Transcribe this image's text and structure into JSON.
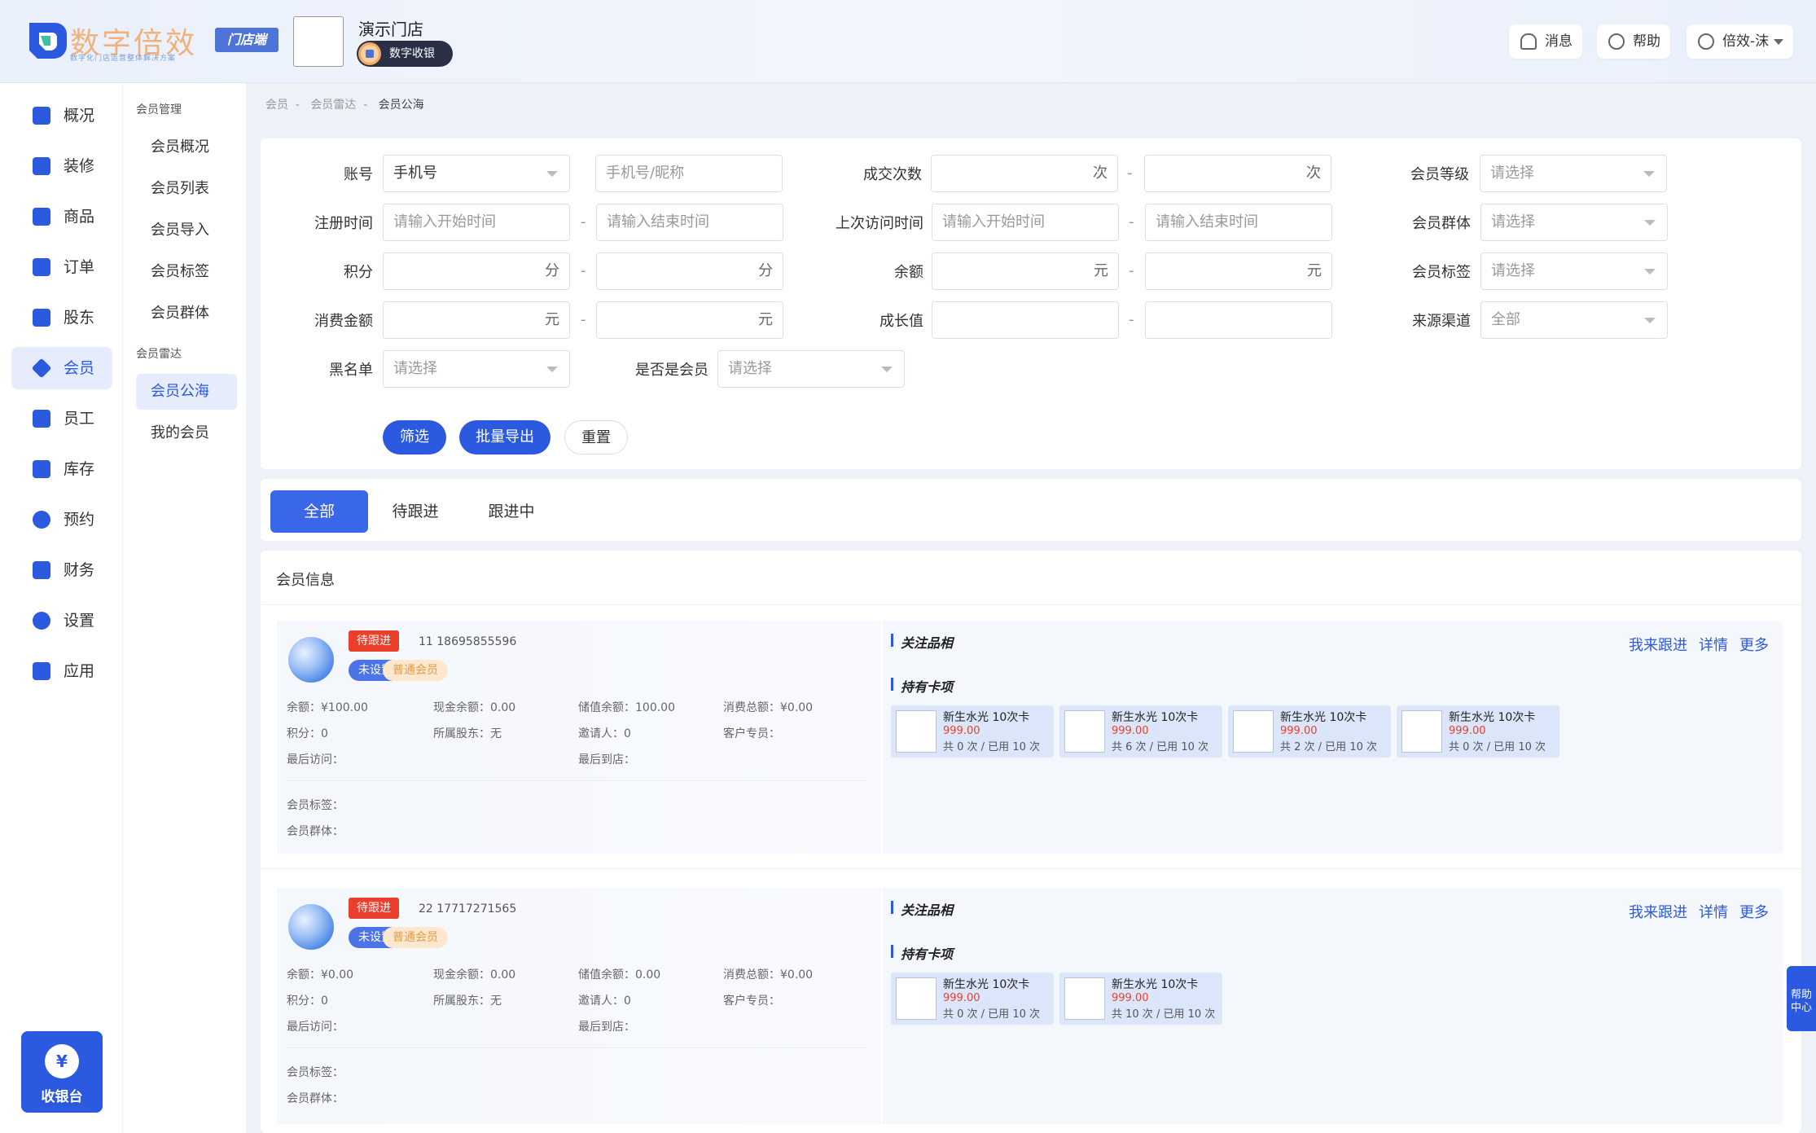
{
  "header": {
    "logo_text": "数字倍效",
    "logo_sub": "数字化门店运营整体解决方案",
    "store_tag": "门店端",
    "store_name": "演示门店",
    "cashier_badge": "数字收银",
    "msg": "消息",
    "help": "帮助",
    "user": "倍效-沫"
  },
  "nav": [
    {
      "label": "概况",
      "icon": "chart-icon"
    },
    {
      "label": "装修",
      "icon": "brush-icon"
    },
    {
      "label": "商品",
      "icon": "goods-icon"
    },
    {
      "label": "订单",
      "icon": "order-icon"
    },
    {
      "label": "股东",
      "icon": "shield-icon"
    },
    {
      "label": "会员",
      "icon": "diamond-icon"
    },
    {
      "label": "员工",
      "icon": "people-icon"
    },
    {
      "label": "库存",
      "icon": "stock-icon"
    },
    {
      "label": "预约",
      "icon": "clock-icon"
    },
    {
      "label": "财务",
      "icon": "finance-icon"
    },
    {
      "label": "设置",
      "icon": "gear-icon"
    },
    {
      "label": "应用",
      "icon": "apps-icon"
    }
  ],
  "cashier": "收银台",
  "sub": {
    "group1": "会员管理",
    "items1": [
      "会员概况",
      "会员列表",
      "会员导入",
      "会员标签",
      "会员群体"
    ],
    "group2": "会员雷达",
    "items2": [
      "会员公海",
      "我的会员"
    ]
  },
  "breadcrumb": [
    "会员",
    "会员雷达",
    "会员公海"
  ],
  "filters": {
    "account": "账号",
    "account_type": "手机号",
    "account_ph": "手机号/昵称",
    "deals": "成交次数",
    "deals_unit": "次",
    "level": "会员等级",
    "select_ph": "请选择",
    "reg_time": "注册时间",
    "start_ph": "请输入开始时间",
    "end_ph": "请输入结束时间",
    "last_visit": "上次访问时间",
    "group": "会员群体",
    "points": "积分",
    "points_unit": "分",
    "balance": "余额",
    "yuan": "元",
    "tag": "会员标签",
    "spend": "消费金额",
    "growth": "成长值",
    "channel": "来源渠道",
    "channel_val": "全部",
    "blacklist": "黑名单",
    "is_member": "是否是会员",
    "btn_filter": "筛选",
    "btn_export": "批量导出",
    "btn_reset": "重置"
  },
  "tabs": [
    "全部",
    "待跟进",
    "跟进中"
  ],
  "list_title": "会员信息",
  "labels": {
    "balance": "余额：",
    "cash": "现金余额：",
    "stored": "储值余额：",
    "total": "消费总额：",
    "points": "积分：",
    "holder": "所属股东：",
    "inviter": "邀请人：",
    "advisor": "客户专员：",
    "last_visit": "最后访问：",
    "last_store": "最后到店：",
    "tags": "会员标签：",
    "groups": "会员群体：",
    "focus": "关注品相",
    "cards": "持有卡项",
    "follow": "我来跟进",
    "detail": "详情",
    "more": "更多"
  },
  "members": [
    {
      "status": "待跟进",
      "id_phone": "11 18695855596",
      "unset": "未设置",
      "level": "普通会员",
      "balance": "¥100.00",
      "cash": "0.00",
      "stored": "100.00",
      "total": "¥0.00",
      "points": "0",
      "holder": "无",
      "inviter": "0",
      "cards": [
        {
          "name": "新生水光 10次卡",
          "price": "999.00",
          "usage": "共 0 次 / 已用 10 次"
        },
        {
          "name": "新生水光 10次卡",
          "price": "999.00",
          "usage": "共 6 次 / 已用 10 次"
        },
        {
          "name": "新生水光 10次卡",
          "price": "999.00",
          "usage": "共 2 次 / 已用 10 次"
        },
        {
          "name": "新生水光 10次卡",
          "price": "999.00",
          "usage": "共 0 次 / 已用 10 次"
        }
      ]
    },
    {
      "status": "待跟进",
      "id_phone": "22 17717271565",
      "unset": "未设置",
      "level": "普通会员",
      "balance": "¥0.00",
      "cash": "0.00",
      "stored": "0.00",
      "total": "¥0.00",
      "points": "0",
      "holder": "无",
      "inviter": "0",
      "cards": [
        {
          "name": "新生水光 10次卡",
          "price": "999.00",
          "usage": "共 0 次 / 已用 10 次"
        },
        {
          "name": "新生水光 10次卡",
          "price": "999.00",
          "usage": "共 10 次 / 已用 10 次"
        }
      ]
    }
  ],
  "help_float": "帮助中心"
}
